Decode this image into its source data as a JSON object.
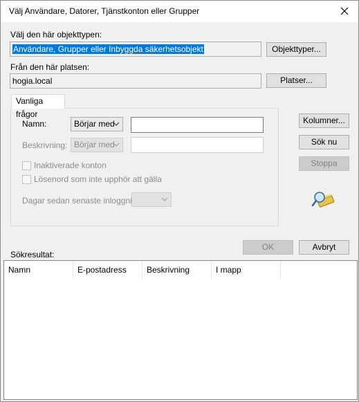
{
  "window": {
    "title": "Välj Användare, Datorer, Tjänstkonton eller Grupper"
  },
  "object_type": {
    "label": "Välj den här objekttypen:",
    "value": "Användare, Grupper eller Inbyggda säkerhetsobjekt",
    "button": "Objekttyper..."
  },
  "location": {
    "label": "Från den här platsen:",
    "value": "hogia.local",
    "button": "Platser..."
  },
  "tab": {
    "label": "Vanliga frågor"
  },
  "query": {
    "name_label": "Namn:",
    "name_mode": "Börjar med",
    "description_label": "Beskrivning:",
    "description_mode": "Börjar med",
    "disabled_accounts": "Inaktiverade konton",
    "non_expiring_pw": "Lösenord som inte upphör att gälla",
    "days_since_login": "Dagar sedan senaste inloggning:"
  },
  "side_buttons": {
    "columns": "Kolumner...",
    "search_now": "Sök nu",
    "stop": "Stoppa"
  },
  "bottom": {
    "results_label": "Sökresultat:",
    "ok": "OK",
    "cancel": "Avbryt"
  },
  "results_table": {
    "columns": [
      "Namn",
      "E-postadress",
      "Beskrivning",
      "I mapp"
    ]
  },
  "colors": {
    "selection": "#0078d7",
    "dialog_bg": "#f0f0f0"
  },
  "icons": {
    "close": "close-icon",
    "search": "search-magnifier-icon",
    "dropdown": "chevron-down-icon"
  }
}
